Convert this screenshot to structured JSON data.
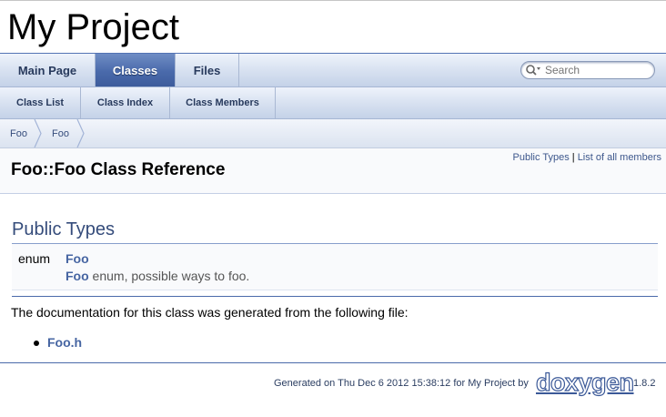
{
  "project": {
    "name": "My Project"
  },
  "nav": {
    "tabs": [
      {
        "label": "Main Page",
        "active": false
      },
      {
        "label": "Classes",
        "active": true
      },
      {
        "label": "Files",
        "active": false
      }
    ],
    "search": {
      "placeholder": "Search",
      "value": ""
    },
    "subtabs": [
      {
        "label": "Class List"
      },
      {
        "label": "Class Index"
      },
      {
        "label": "Class Members"
      }
    ],
    "breadcrumb": [
      "Foo",
      "Foo"
    ]
  },
  "header": {
    "summary": {
      "public_types": "Public Types",
      "separator": "|",
      "all_members": "List of all members"
    },
    "title": "Foo::Foo Class Reference"
  },
  "sections": {
    "public_types": {
      "heading": "Public Types",
      "members": [
        {
          "type": "enum",
          "name": "Foo",
          "brief_link": "Foo",
          "brief_text": " enum, possible ways to foo."
        }
      ]
    }
  },
  "doc": {
    "generated_from": "The documentation for this class was generated from the following file:",
    "files": [
      "Foo.h"
    ]
  },
  "footer": {
    "generated": "Generated on Thu Dec 6 2012 15:38:12 for My Project by",
    "logo": "doxygen",
    "version": "1.8.2"
  },
  "colors": {
    "accent": "#4665a2",
    "active_tab": "#4a6aab",
    "heading": "#354c7b"
  },
  "icons": {
    "search": "search-icon"
  }
}
